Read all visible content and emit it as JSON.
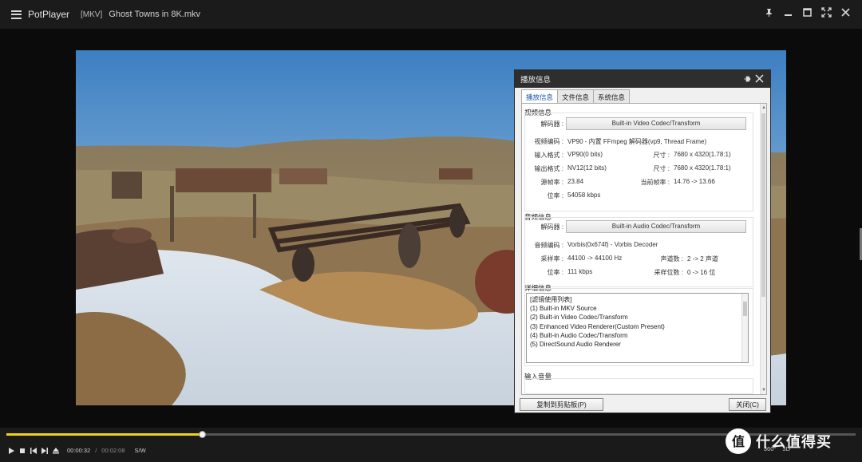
{
  "titlebar": {
    "app_name": "PotPlayer",
    "file_tag": "[MKV]",
    "file_name": "Ghost Towns in 8K.mkv"
  },
  "dialog": {
    "title": "播放信息",
    "tabs": [
      {
        "label": "播放信息",
        "active": true
      },
      {
        "label": "文件信息",
        "active": false
      },
      {
        "label": "系统信息",
        "active": false
      }
    ],
    "video": {
      "title": "视频信息",
      "decoder_label": "解码器 :",
      "decoder_button": "Built-in Video Codec/Transform",
      "codec_label": "视频编码 :",
      "codec_value": "VP90 - 内置 FFmpeg 解码器(vp9, Thread Frame)",
      "input_format_label": "输入格式 :",
      "input_format_value": "VP90(0 bits)",
      "input_size_label": "尺寸 :",
      "input_size_value": "7680 x 4320(1.78:1)",
      "output_format_label": "输出格式 :",
      "output_format_value": "NV12(12 bits)",
      "output_size_label": "尺寸 :",
      "output_size_value": "7680 x 4320(1.78:1)",
      "source_fps_label": "源帧率 :",
      "source_fps_value": "23.84",
      "current_fps_label": "当前帧率 :",
      "current_fps_value": "14.76 -> 13.66",
      "bitrate_label": "位率 :",
      "bitrate_value": "54058 kbps"
    },
    "audio": {
      "title": "音频信息",
      "decoder_label": "解码器 :",
      "decoder_button": "Built-in Audio Codec/Transform",
      "codec_label": "音频编码 :",
      "codec_value": "Vorbis(0x674f) - Vorbis Decoder",
      "sample_rate_label": "采样率 :",
      "sample_rate_value": "44100 -> 44100 Hz",
      "channels_label": "声道数 :",
      "channels_value": "2 -> 2 声道",
      "bitrate_label": "位率 :",
      "bitrate_value": "111 kbps",
      "bit_depth_label": "采样位数 :",
      "bit_depth_value": "0 -> 16 位"
    },
    "details": {
      "title": "详细信息",
      "list": [
        "[滤镜使用列表]",
        "(1) Built-in MKV Source",
        "(2) Built-in Video Codec/Transform",
        "(3) Enhanced Video Renderer(Custom Present)",
        "(4) Built-in Audio Codec/Transform",
        "(5) DirectSound Audio Renderer"
      ]
    },
    "input_volume_title": "输入音量",
    "copy_button": "复制到剪贴板(P)",
    "close_button": "关闭(C)"
  },
  "playback": {
    "progress": 0.23,
    "current_time": "00:00:32",
    "separator": "/",
    "total_time": "00:02:08",
    "sw_label": "S/W",
    "right_labels": [
      "360°",
      "3D"
    ]
  },
  "watermark": {
    "text": "什么值得买",
    "badge": "值"
  },
  "colors": {
    "accent": "#f0d315",
    "titlebar": "#1b1b1b",
    "dialog_bg": "#f0f0f0",
    "tab_active_text": "#1d57a8"
  }
}
